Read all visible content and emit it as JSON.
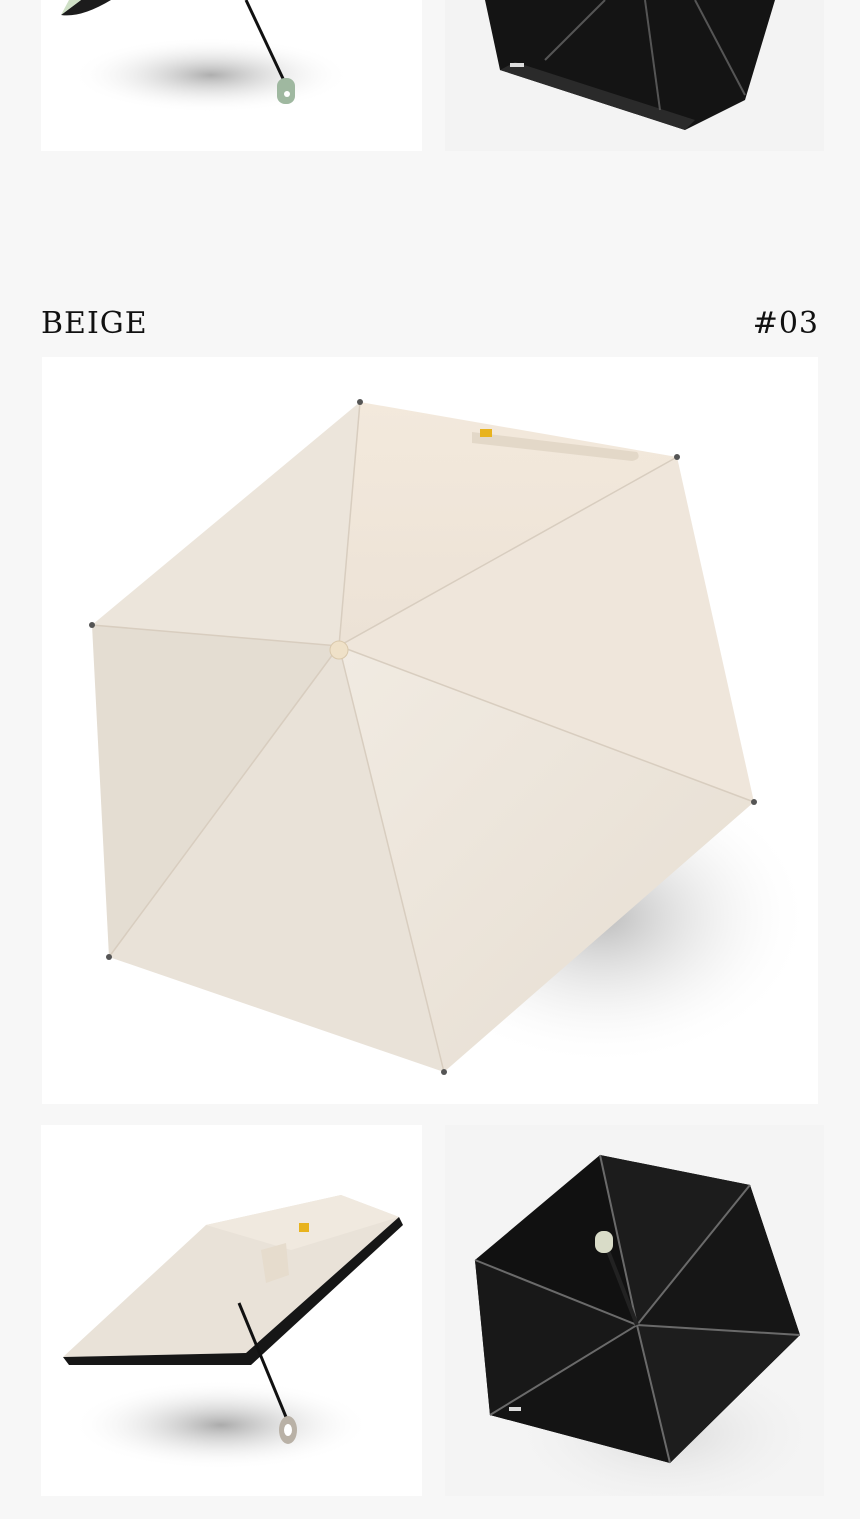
{
  "section": {
    "color_name": "BEIGE",
    "color_code": "#03"
  },
  "colors": {
    "page_background": "#f7f7f7",
    "canopy_beige": "#ebe4da",
    "canopy_green": "#cfe0c6",
    "canopy_black": "#121212",
    "handle_green": "#9fb8a0",
    "label_yellow": "#e8b31e"
  },
  "images": [
    {
      "name": "green-umbrella-side-view-photo",
      "icon": "umbrella-photo"
    },
    {
      "name": "green-umbrella-underside-photo",
      "icon": "umbrella-photo"
    },
    {
      "name": "beige-umbrella-top-view-photo",
      "icon": "umbrella-photo"
    },
    {
      "name": "beige-umbrella-side-view-photo",
      "icon": "umbrella-photo"
    },
    {
      "name": "beige-umbrella-underside-photo",
      "icon": "umbrella-photo"
    }
  ]
}
